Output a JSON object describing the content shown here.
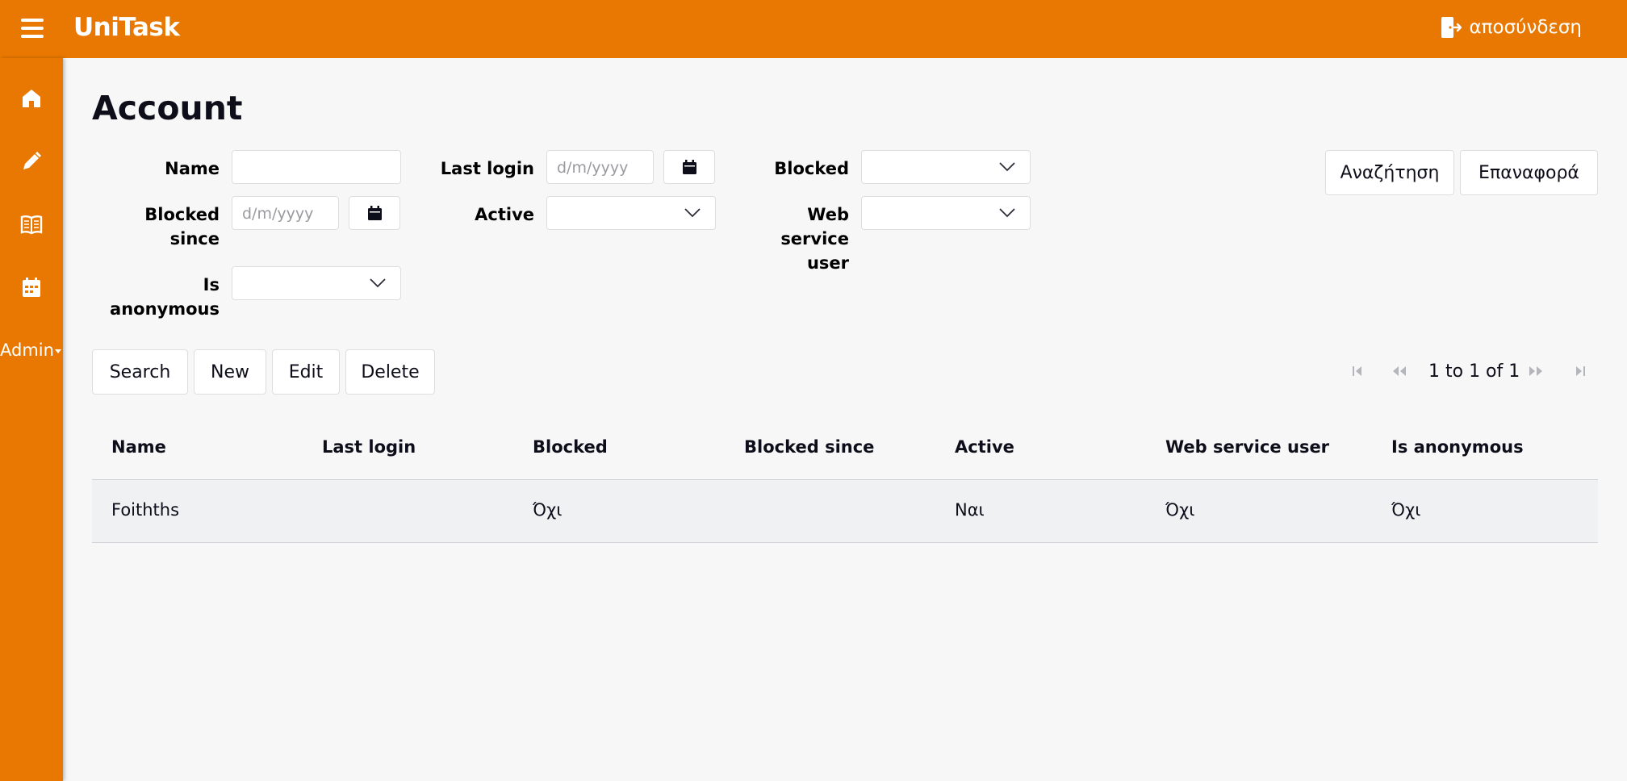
{
  "app": {
    "brand": "UniTask",
    "logout_label": "αποσύνδεση"
  },
  "sidebar": {
    "items": [
      {
        "name": "home",
        "icon": "home-icon"
      },
      {
        "name": "edit",
        "icon": "pencil-icon"
      },
      {
        "name": "catalog",
        "icon": "book-icon"
      },
      {
        "name": "calendar",
        "icon": "calendar-icon"
      }
    ],
    "admin_label": "Admin"
  },
  "page": {
    "title": "Account"
  },
  "filters": {
    "name_label": "Name",
    "name_value": "",
    "last_login_label": "Last login",
    "last_login_placeholder": "d/m/yyyy",
    "blocked_label": "Blocked",
    "blocked_value": "",
    "blocked_since_label": "Blocked since",
    "blocked_since_placeholder": "d/m/yyyy",
    "active_label": "Active",
    "active_value": "",
    "web_service_user_label": "Web service user",
    "web_service_user_value": "",
    "is_anonymous_label": "Is anonymous",
    "is_anonymous_value": "",
    "search_label": "Αναζήτηση",
    "reset_label": "Επαναφορά"
  },
  "toolbar": {
    "search_label": "Search",
    "new_label": "New",
    "edit_label": "Edit",
    "delete_label": "Delete",
    "pagination_text": "1 to 1 of 1"
  },
  "table": {
    "columns": [
      "Name",
      "Last login",
      "Blocked",
      "Blocked since",
      "Active",
      "Web service user",
      "Is anonymous"
    ],
    "rows": [
      [
        "Foithths",
        "",
        "Όχι",
        "",
        "Ναι",
        "Όχι",
        "Όχι"
      ]
    ]
  },
  "colors": {
    "accent": "#e87801",
    "background": "#f7f7f7",
    "row_background": "#f0f1f3"
  }
}
